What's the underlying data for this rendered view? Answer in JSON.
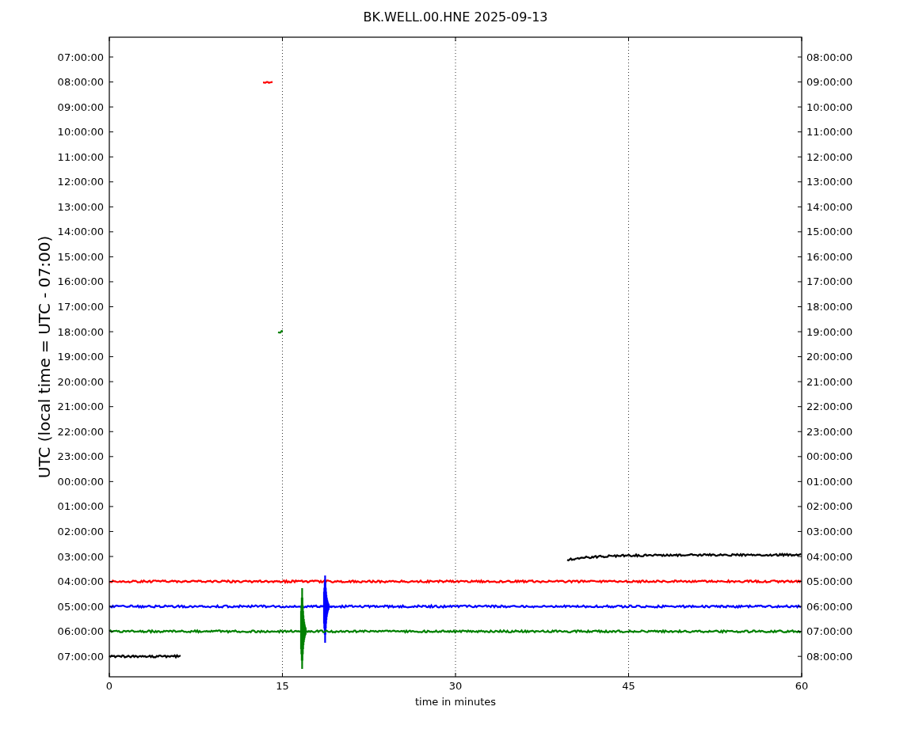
{
  "title": "BK.WELL.00.HNE 2025-09-13",
  "ylabel": "UTC (local time = UTC - 07:00)",
  "xlabel": "time in minutes",
  "xticks": [
    "0",
    "15",
    "30",
    "45",
    "60"
  ],
  "rows": [
    {
      "left": "07:00:00",
      "right": "08:00:00"
    },
    {
      "left": "08:00:00",
      "right": "09:00:00"
    },
    {
      "left": "09:00:00",
      "right": "10:00:00"
    },
    {
      "left": "10:00:00",
      "right": "11:00:00"
    },
    {
      "left": "11:00:00",
      "right": "12:00:00"
    },
    {
      "left": "12:00:00",
      "right": "13:00:00"
    },
    {
      "left": "13:00:00",
      "right": "14:00:00"
    },
    {
      "left": "14:00:00",
      "right": "15:00:00"
    },
    {
      "left": "15:00:00",
      "right": "16:00:00"
    },
    {
      "left": "16:00:00",
      "right": "17:00:00"
    },
    {
      "left": "17:00:00",
      "right": "18:00:00"
    },
    {
      "left": "18:00:00",
      "right": "19:00:00"
    },
    {
      "left": "19:00:00",
      "right": "20:00:00"
    },
    {
      "left": "20:00:00",
      "right": "21:00:00"
    },
    {
      "left": "21:00:00",
      "right": "22:00:00"
    },
    {
      "left": "22:00:00",
      "right": "23:00:00"
    },
    {
      "left": "23:00:00",
      "right": "00:00:00"
    },
    {
      "left": "00:00:00",
      "right": "01:00:00"
    },
    {
      "left": "01:00:00",
      "right": "02:00:00"
    },
    {
      "left": "02:00:00",
      "right": "03:00:00"
    },
    {
      "left": "03:00:00",
      "right": "04:00:00"
    },
    {
      "left": "04:00:00",
      "right": "05:00:00"
    },
    {
      "left": "05:00:00",
      "right": "06:00:00"
    },
    {
      "left": "06:00:00",
      "right": "07:00:00"
    },
    {
      "left": "07:00:00",
      "right": "08:00:00"
    }
  ]
}
